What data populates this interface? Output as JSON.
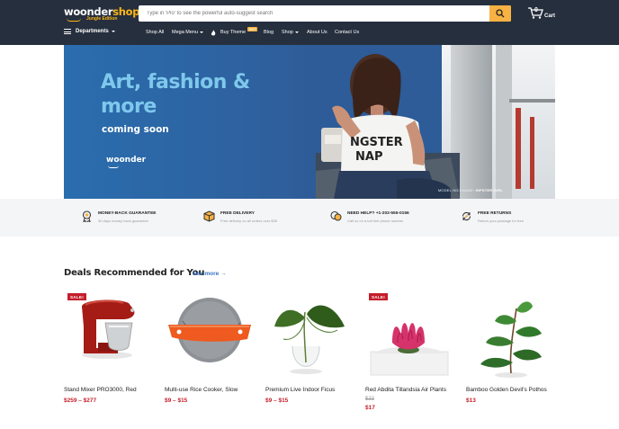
{
  "header": {
    "logo_main": "woonder",
    "logo_accent": "shop",
    "logo_edition": "Jungle Edition",
    "search_placeholder": "Type in 'Plo' to see the powerful auto-suggest search",
    "cart_count": "0",
    "cart_label": "Cart"
  },
  "nav": {
    "departments_label": "Departments",
    "items": [
      {
        "label": "Shop All"
      },
      {
        "label": "Mega Menu"
      },
      {
        "label": "Buy Theme"
      },
      {
        "label": "Blog"
      },
      {
        "label": "Shop"
      },
      {
        "label": "About Us"
      },
      {
        "label": "Contact Us"
      }
    ],
    "hot_badge": "HOT"
  },
  "hero": {
    "title": "Art, fashion & more",
    "subtitle": "coming soon",
    "brand": "woonder",
    "caption_prefix": "MODEL NICKNAME:",
    "caption_name": "HIPSTER GIRL",
    "shirt_text_1": "NGSTER",
    "shirt_text_2": "NAP"
  },
  "features": [
    {
      "title": "MONEY-BACK GUARANTEE",
      "text": "30 days money back guarantee",
      "icon": "medal-icon"
    },
    {
      "title": "FREE DELIVERY",
      "text": "Free delivery on all orders over $35",
      "icon": "box-icon"
    },
    {
      "title": "NEED HELP? +1-202-555-0156",
      "text": "Call us on a toll free phone number",
      "icon": "chat-icon"
    },
    {
      "title": "FREE RETURNS",
      "text": "Return your package for free",
      "icon": "returns-icon"
    }
  ],
  "deals": {
    "title": "Deals Recommended for You",
    "see_more": "See more →",
    "sale_label": "SALE!",
    "products": [
      {
        "name": "Stand Mixer PRO3000, Red",
        "price": "$259 – $277",
        "sale": true
      },
      {
        "name": "Multi-use Rice Cooker, Slow",
        "price": "$9 – $15",
        "sale": false
      },
      {
        "name": "Premium Live Indoor Ficus",
        "price": "$9 – $15",
        "sale": false
      },
      {
        "name": "Red Abdita Tillandsia Air Plants",
        "old_price": "$22",
        "price": "$17",
        "sale": true
      },
      {
        "name": "Bamboo Golden Devil's Pothos",
        "price": "$13",
        "sale": false
      }
    ]
  },
  "colors": {
    "header_bg": "#262f3e",
    "accent": "#f8b243",
    "sale_red": "#c41e2b",
    "link_blue": "#3a73c4",
    "hero_title": "#7ec8ec"
  }
}
